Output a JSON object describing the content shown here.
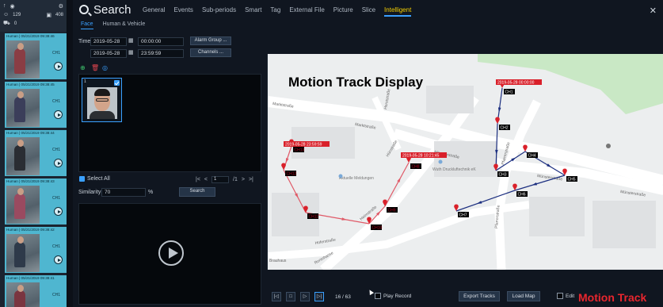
{
  "strip": {
    "count_a": "129",
    "count_b": "408",
    "count_c": "0",
    "events": [
      {
        "header": "Human | 05/21/2019 09:38:46",
        "channel": "CH1"
      },
      {
        "header": "Human | 05/21/2019 09:38:45",
        "channel": "CH1"
      },
      {
        "header": "Human | 05/21/2019 09:38:44",
        "channel": "CH1"
      },
      {
        "header": "Human | 05/21/2019 09:38:43",
        "channel": "CH1"
      },
      {
        "header": "Human | 05/21/2019 09:38:42",
        "channel": "CH1"
      },
      {
        "header": "Human | 05/21/2019 09:38:41",
        "channel": "CH1"
      }
    ]
  },
  "header": {
    "title": "Search",
    "tabs": [
      "General",
      "Events",
      "Sub-periods",
      "Smart",
      "Tag",
      "External File",
      "Picture",
      "Slice",
      "Intelligent"
    ],
    "active_tab": "Intelligent"
  },
  "subtabs": [
    "Face",
    "Human & Vehicle"
  ],
  "form": {
    "time_label": "Time",
    "start_date": "2019-05-28",
    "start_time": "00:00:00",
    "end_date": "2019-05-28",
    "end_time": "23:59:59",
    "alarm_group": "Alarm Group ...",
    "channels": "Channels ..."
  },
  "faces": [
    {
      "index": "1"
    }
  ],
  "list_controls": {
    "select_all": "Select All",
    "page": "1",
    "page_total": "/1",
    "similarity_label": "Similarity",
    "similarity_value": "70",
    "percent": "%",
    "search_button": "Search"
  },
  "map": {
    "title": "Motion Track Display",
    "streets": [
      "Marktstraße",
      "Marktstraße",
      "Münsterstraße",
      "Münsterstraße",
      "Münsterstraße",
      "Hünstraße",
      "Pfarrerstraße",
      "Pfarrerstraße",
      "Horststraße",
      "Hoferstraße",
      "Heimstraße",
      "Roninhanse",
      "Brauhaus"
    ],
    "pois": [
      "Aktuelle Meldungen",
      "Wuth Druckluftechnik eK"
    ],
    "red_timestamps": [
      "2019-05-28 23:59:59",
      "2019-05-28 10:21:45"
    ],
    "blue_timestamp": "2019-05-28 00:00:00",
    "red_track": [
      "CH13",
      "CH12",
      "CH11",
      "CH10",
      "CH9",
      "CH8"
    ],
    "blue_track": [
      "CH1",
      "CH2",
      "CH3",
      "CH4",
      "CH5",
      "CH6",
      "CH7"
    ],
    "colors": {
      "red_track": "#e05a68",
      "blue_track": "#1c2f80",
      "red_label": "#ef8f9c",
      "blue_label": "#5b6fb6"
    }
  },
  "footer": {
    "counter": "16 / 63",
    "play_record": "Play Record",
    "export_tracks": "Export Tracks",
    "load_map": "Load Map",
    "edit": "Edit"
  },
  "caption": "Motion Track"
}
